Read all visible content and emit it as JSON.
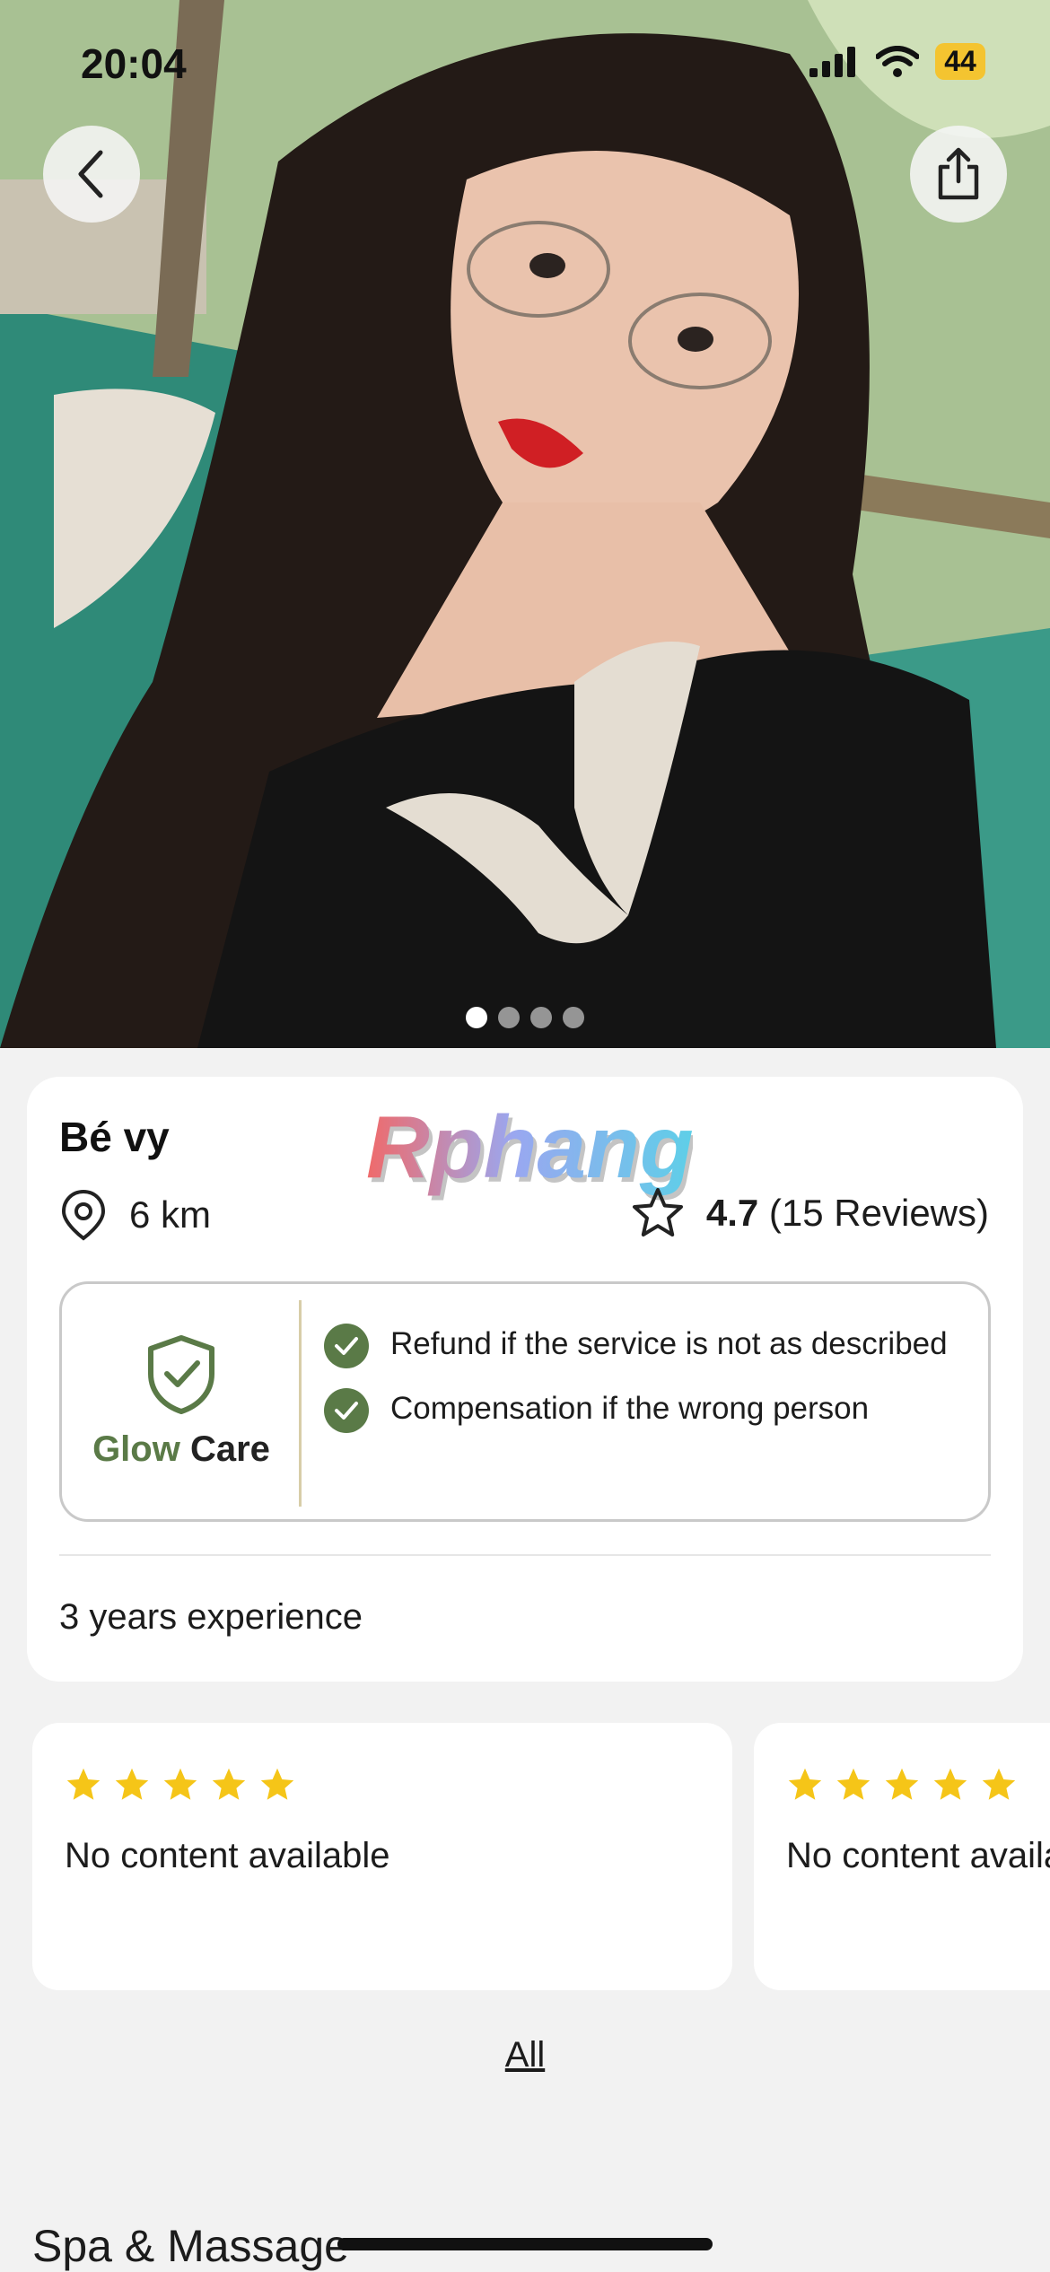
{
  "status_bar": {
    "time": "20:04",
    "battery": "44"
  },
  "hero": {
    "photo_count": 4,
    "active_index": 0
  },
  "icons": {
    "back": "chevron-left-icon",
    "share": "share-icon",
    "location": "location-pin-icon",
    "star": "star-outline-icon",
    "shield": "shield-check-icon",
    "check": "check-circle-icon"
  },
  "profile": {
    "name": "Bé vy",
    "watermark": "Rphang",
    "distance": "6 km",
    "rating": "4.7",
    "reviews_label": "(15 Reviews)",
    "experience": "3 years experience"
  },
  "guarantee": {
    "brand_word1": "Glow",
    "brand_word2": "Care",
    "items": [
      "Refund if the service is not as described",
      "Compensation if the wrong person"
    ]
  },
  "reviews": [
    {
      "stars": 5,
      "text": "No content available"
    },
    {
      "stars": 5,
      "text": "No content available"
    }
  ],
  "all_link": "All",
  "next_section_title": "Spa & Massage",
  "colors": {
    "accent_green": "#5a7a47",
    "star_yellow": "#f5c518",
    "card_bg": "#ffffff",
    "page_bg": "#f2f2f2"
  }
}
